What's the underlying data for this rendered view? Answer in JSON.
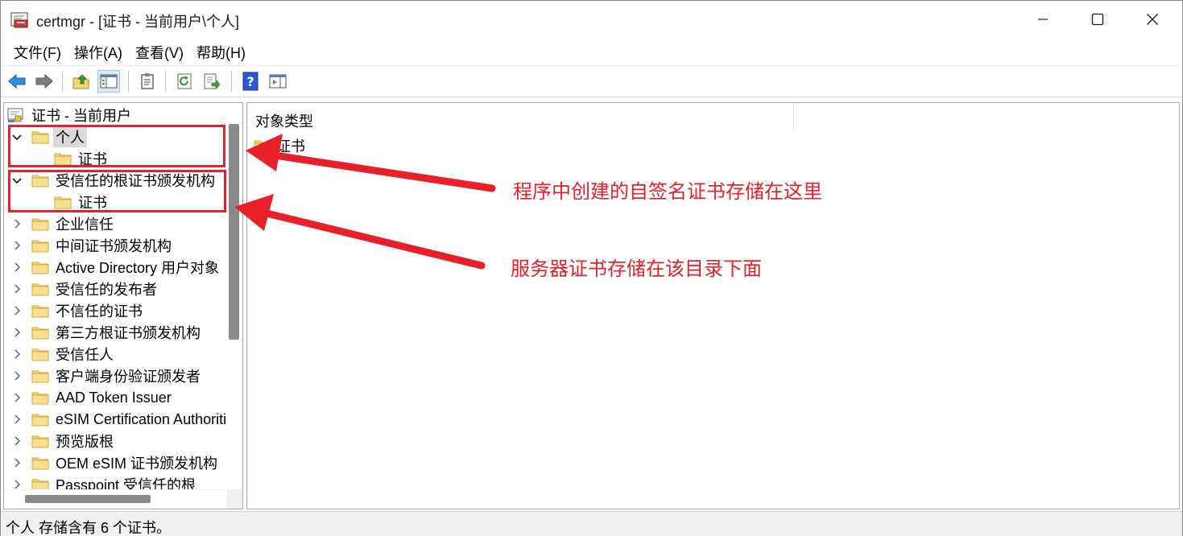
{
  "window": {
    "title": "certmgr - [证书 - 当前用户\\个人]"
  },
  "menu": [
    {
      "label": "文件(F)"
    },
    {
      "label": "操作(A)"
    },
    {
      "label": "查看(V)"
    },
    {
      "label": "帮助(H)"
    }
  ],
  "toolbar": {
    "buttons": [
      "back-icon",
      "forward-icon",
      "up-folder-icon",
      "show-hide-tree-icon",
      "properties-icon",
      "refresh-icon",
      "export-list-icon",
      "help-icon",
      "action-pane-icon"
    ]
  },
  "tree": {
    "root": "证书 - 当前用户",
    "items": [
      {
        "label": "个人",
        "expanded": true,
        "selected": true,
        "children": [
          "证书"
        ]
      },
      {
        "label": "受信任的根证书颁发机构",
        "expanded": true,
        "children": [
          "证书"
        ]
      },
      {
        "label": "企业信任"
      },
      {
        "label": "中间证书颁发机构"
      },
      {
        "label": "Active Directory 用户对象"
      },
      {
        "label": "受信任的发布者"
      },
      {
        "label": "不信任的证书"
      },
      {
        "label": "第三方根证书颁发机构"
      },
      {
        "label": "受信任人"
      },
      {
        "label": "客户端身份验证颁发者"
      },
      {
        "label": "AAD Token Issuer"
      },
      {
        "label": "eSIM Certification Authorities"
      },
      {
        "label": "预览版根"
      },
      {
        "label": "OEM eSIM 证书颁发机构"
      },
      {
        "label": "Passpoint 受信任的根"
      }
    ]
  },
  "detail": {
    "column_header": "对象类型",
    "rows": [
      {
        "label": "证书"
      }
    ]
  },
  "status": {
    "text": "个人 存储含有 6 个证书。"
  },
  "annotations": {
    "note1": "程序中创建的自签名证书存储在这里",
    "note2": "服务器证书存储在该目录下面",
    "color": "#e8202a"
  },
  "colors": {
    "folder": "#f6d377",
    "folder_edge": "#d7a93a",
    "scroll_thumb": "#8a8a8a",
    "help_blue": "#2a5bd7"
  }
}
